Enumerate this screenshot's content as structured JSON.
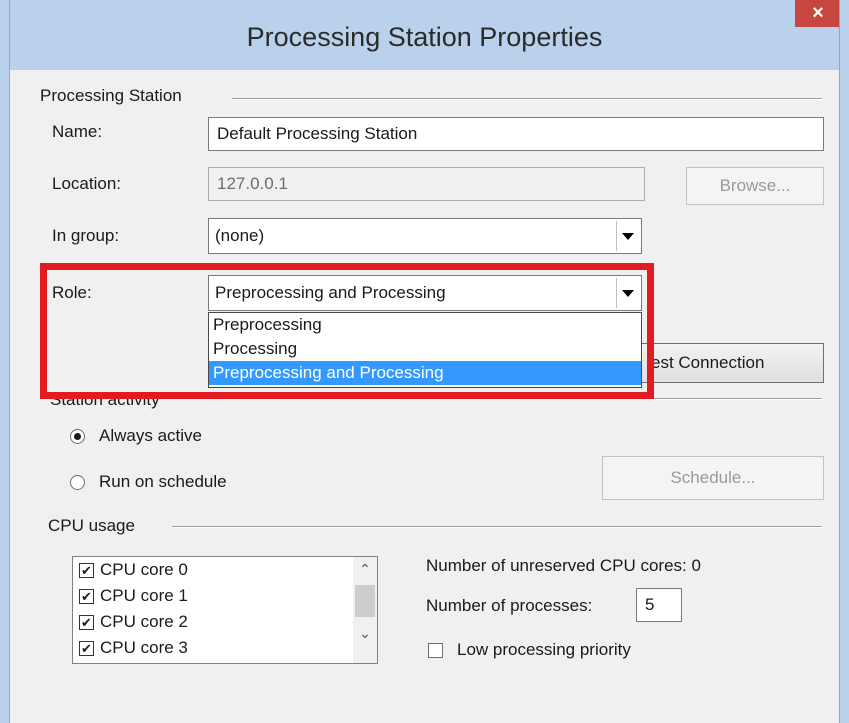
{
  "window": {
    "title": "Processing Station Properties",
    "close_glyph": "×"
  },
  "processing_station": {
    "group_label": "Processing Station",
    "name_label": "Name:",
    "name_value": "Default Processing Station",
    "location_label": "Location:",
    "location_value": "127.0.0.1",
    "browse_label": "Browse...",
    "in_group_label": "In group:",
    "in_group_value": "(none)",
    "role_label": "Role:",
    "role_value": "Preprocessing and Processing",
    "role_options": [
      "Preprocessing",
      "Processing",
      "Preprocessing and Processing"
    ],
    "test_connection_label": "est Connection"
  },
  "station_activity": {
    "group_label": "Station activity",
    "always_active_label": "Always active",
    "run_on_schedule_label": "Run on schedule",
    "schedule_label": "Schedule..."
  },
  "cpu_usage": {
    "group_label": "CPU usage",
    "cores": [
      {
        "label": "CPU core 0",
        "checked": true
      },
      {
        "label": "CPU core 1",
        "checked": true
      },
      {
        "label": "CPU core 2",
        "checked": true
      },
      {
        "label": "CPU core 3",
        "checked": true
      }
    ],
    "unreserved_label": "Number of unreserved CPU cores: 0",
    "processes_label": "Number of processes:",
    "processes_value": "5",
    "low_priority_label": "Low processing priority",
    "check_glyph": "✔"
  },
  "colors": {
    "highlight": "#e21b23",
    "selected_option": "#3399ff",
    "titlebar": "#b9d1ea",
    "close_button": "#c7463f"
  }
}
